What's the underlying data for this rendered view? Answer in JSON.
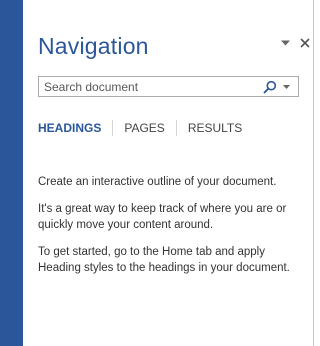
{
  "pane": {
    "title": "Navigation",
    "task_pane_options_icon": "chevron-down-icon",
    "close_icon": "close-icon"
  },
  "search": {
    "placeholder": "Search document",
    "value": "",
    "search_icon": "magnifier-icon",
    "dropdown_icon": "chevron-down-icon"
  },
  "tabs": [
    {
      "label": "HEADINGS",
      "active": true
    },
    {
      "label": "PAGES",
      "active": false
    },
    {
      "label": "RESULTS",
      "active": false
    }
  ],
  "description": [
    "Create an interactive outline of your document.",
    "It's a great way to keep track of where you are or quickly move your content around.",
    "To get started, go to the Home tab and apply Heading styles to the headings in your document."
  ],
  "colors": {
    "accent": "#2b579a",
    "text": "#333333",
    "border": "#ababab"
  }
}
